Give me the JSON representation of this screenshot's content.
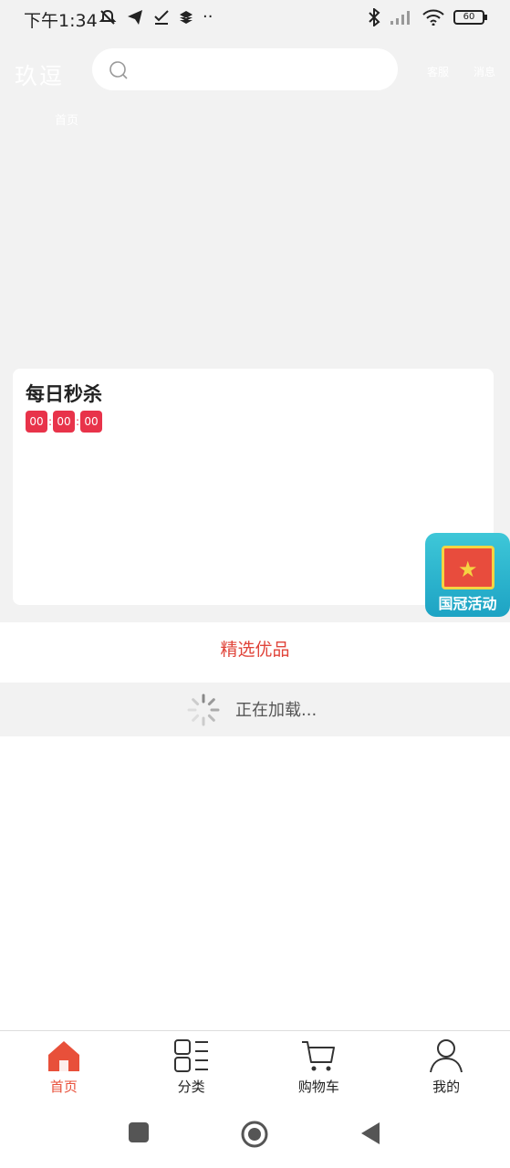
{
  "status_bar": {
    "time": "下午1:34",
    "battery": "60",
    "icons": [
      "mute-icon",
      "telegram-icon",
      "check-icon",
      "layers-icon",
      "more-dots-icon",
      "bluetooth-icon",
      "signal-icon",
      "wifi-icon",
      "battery-icon"
    ]
  },
  "header": {
    "logo": "玖逗",
    "search_placeholder": "",
    "service_label": "客服",
    "message_label": "消息",
    "nav_tab": "首页"
  },
  "flash_sale": {
    "title": "每日秒杀",
    "countdown": [
      "00",
      "00",
      "00"
    ],
    "separator": ":"
  },
  "promo": {
    "label": "国冠活动"
  },
  "featured": {
    "title": "精选优品",
    "loading_text": "正在加载..."
  },
  "tabbar": {
    "items": [
      {
        "label": "首页",
        "icon": "home-icon",
        "active": true
      },
      {
        "label": "分类",
        "icon": "category-icon",
        "active": false
      },
      {
        "label": "购物车",
        "icon": "cart-icon",
        "active": false
      },
      {
        "label": "我的",
        "icon": "user-icon",
        "active": false
      }
    ]
  },
  "colors": {
    "accent": "#e8503a",
    "countdown": "#e8334a",
    "background": "#f2f2f2"
  }
}
